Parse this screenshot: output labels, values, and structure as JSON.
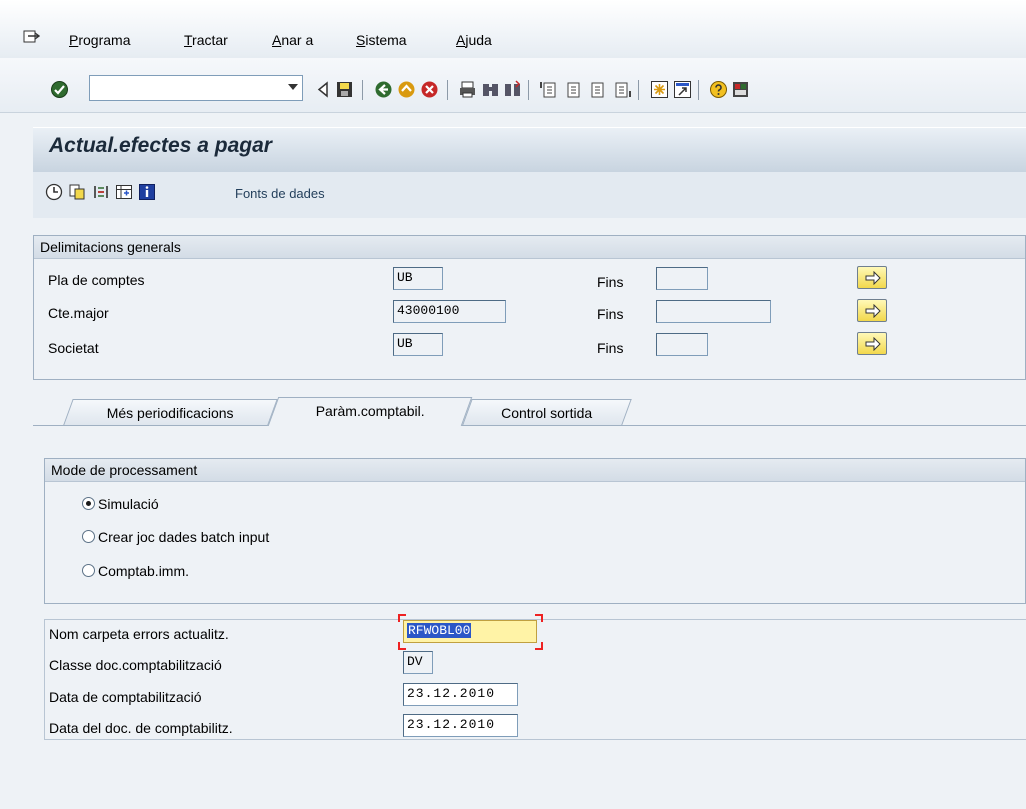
{
  "menu": {
    "items": [
      "Programa",
      "Tractar",
      "Anar a",
      "Sistema",
      "Ajuda"
    ]
  },
  "toolbar": {
    "command_value": "",
    "icons": [
      "check-icon",
      "back-triangle-icon",
      "save-icon",
      "back-icon",
      "exit-icon",
      "cancel-icon",
      "print-icon",
      "find-icon",
      "find-next-icon",
      "first-page-icon",
      "prev-page-icon",
      "next-page-icon",
      "last-page-icon",
      "create-session-icon",
      "shortcut-icon",
      "help-icon",
      "layout-icon"
    ]
  },
  "page": {
    "title": "Actual.efectes a pagar",
    "app_toolbar": {
      "icons": [
        "execute-icon",
        "variants-icon",
        "selection-options-icon",
        "dynamic-selection-icon",
        "info-icon"
      ],
      "link": "Fonts de dades"
    }
  },
  "general": {
    "header": "Delimitacions generals",
    "rows": [
      {
        "label": "Pla de comptes",
        "value": "UB",
        "to_label": "Fins",
        "to_value": ""
      },
      {
        "label": "Cte.major",
        "value": "43000100",
        "to_label": "Fins",
        "to_value": ""
      },
      {
        "label": "Societat",
        "value": "UB",
        "to_label": "Fins",
        "to_value": ""
      }
    ]
  },
  "tabs": [
    "Més periodificacions",
    "Paràm.comptabil.",
    "Control sortida"
  ],
  "active_tab": "Paràm.comptabil.",
  "processing": {
    "header": "Mode de processament",
    "options": [
      "Simulació",
      "Crear joc dades batch input",
      "Comptab.imm."
    ],
    "selected": "Simulació"
  },
  "params": {
    "rows": [
      {
        "label": "Nom carpeta errors actualitz.",
        "value": "RFWOBL00"
      },
      {
        "label": "Classe doc.comptabilització",
        "value": "DV"
      },
      {
        "label": "Data de comptabilització",
        "value": "23.12.2010"
      },
      {
        "label": "Data del doc. de comptabilitz.",
        "value": "23.12.2010"
      }
    ]
  },
  "colors": {
    "accent": "#2b57c7",
    "focus_bg": "#fff3a6",
    "arrow_btn": "#f2d84c"
  }
}
